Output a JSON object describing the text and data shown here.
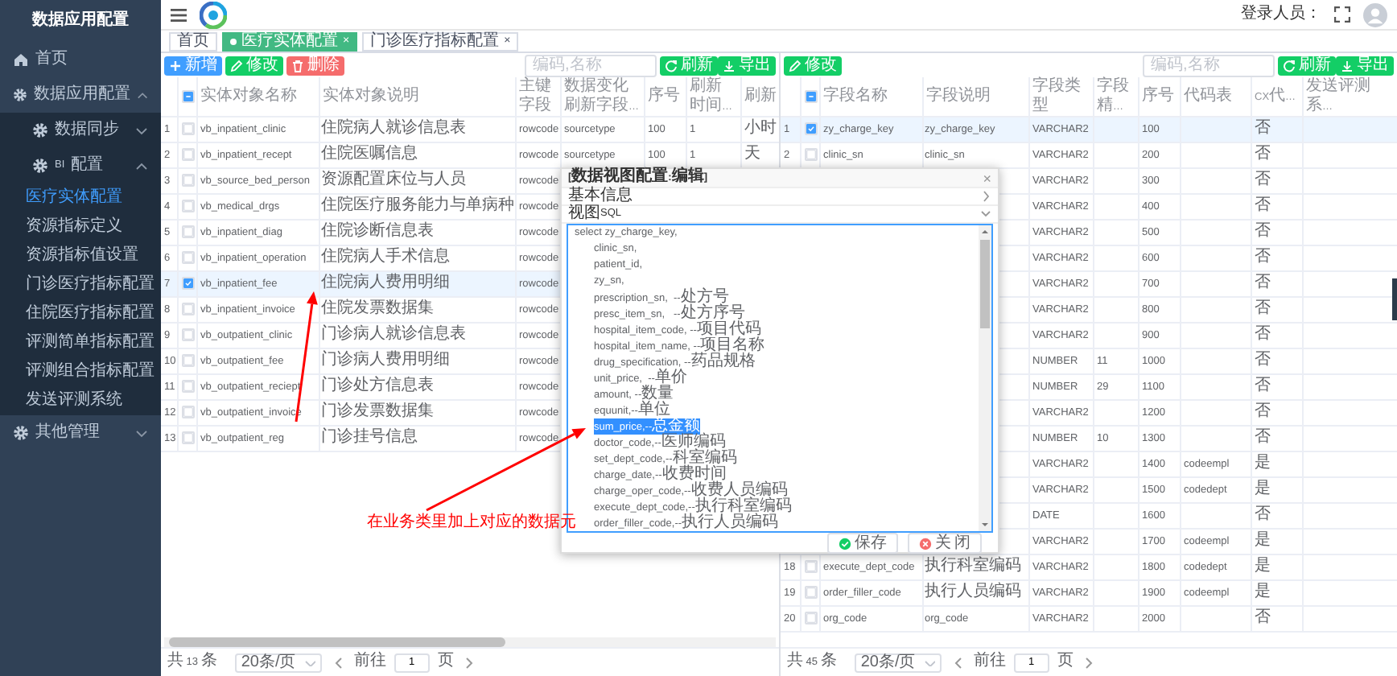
{
  "sidebar": {
    "title": "数据应用配置",
    "items": [
      {
        "label": "首页",
        "kind": "link"
      },
      {
        "label": "数据应用配置",
        "kind": "group",
        "expanded": true,
        "children": [
          {
            "label": "数据同步",
            "kind": "group",
            "expanded": false
          },
          {
            "label": "BI配置",
            "kind": "group",
            "expanded": true,
            "children": [
              {
                "label": "医疗实体配置",
                "selected": true
              },
              {
                "label": "资源指标定义",
                "selected": false
              },
              {
                "label": "资源指标值设置",
                "selected": false
              },
              {
                "label": "门诊医疗指标配置",
                "selected": false
              },
              {
                "label": "住院医疗指标配置",
                "selected": false
              },
              {
                "label": "评测简单指标配置",
                "selected": false
              },
              {
                "label": "评测组合指标配置",
                "selected": false
              },
              {
                "label": "发送评测系统",
                "selected": false
              }
            ]
          }
        ]
      },
      {
        "label": "其他管理",
        "kind": "group",
        "expanded": false
      }
    ]
  },
  "header": {
    "user_label": "登录人员："
  },
  "tabs": [
    {
      "label": "首页",
      "selected": false
    },
    {
      "label": "医疗实体配置",
      "selected": true,
      "close": "×"
    },
    {
      "label": "门诊医疗指标配置",
      "selected": false,
      "close": "×"
    }
  ],
  "left_panel": {
    "buttons": [
      {
        "label": "新增",
        "kind": "add"
      },
      {
        "label": "修改",
        "kind": "edit"
      },
      {
        "label": "删除",
        "kind": "delete"
      }
    ],
    "search": {
      "placeholder": "编码,名称"
    },
    "actions": [
      {
        "label": "刷新",
        "kind": "refresh"
      },
      {
        "label": "导出",
        "kind": "export"
      }
    ],
    "table": {
      "header_checkbox": {
        "partial": true
      },
      "columns": [
        "实体对象名称",
        "实体对象说明",
        "主键字段",
        "数据变化刷新字段…",
        "序号",
        "刷新时间…",
        "刷新"
      ],
      "rows": [
        {
          "index": "1",
          "checked": false,
          "selected": false,
          "cells": [
            "vb_inpatient_clinic",
            "住院病人就诊信息表",
            "rowcode",
            "sourcetype",
            "100",
            "1",
            "小时"
          ]
        },
        {
          "index": "2",
          "checked": false,
          "selected": false,
          "cells": [
            "vb_inpatient_recept",
            "住院医嘱信息",
            "rowcode",
            "sourcetype",
            "100",
            "1",
            "天"
          ]
        },
        {
          "index": "3",
          "checked": false,
          "selected": false,
          "cells": [
            "vb_source_bed_person",
            "资源配置床位与人员",
            "rowcode"
          ]
        },
        {
          "index": "4",
          "checked": false,
          "selected": false,
          "cells": [
            "vb_medical_drgs",
            "住院医疗服务能力与单病种",
            "rowcode"
          ]
        },
        {
          "index": "5",
          "checked": false,
          "selected": false,
          "cells": [
            "vb_inpatient_diag",
            "住院诊断信息表",
            "rowcode"
          ]
        },
        {
          "index": "6",
          "checked": false,
          "selected": false,
          "cells": [
            "vb_inpatient_operation",
            "住院病人手术信息",
            "rowcode"
          ]
        },
        {
          "index": "7",
          "checked": true,
          "selected": true,
          "cells": [
            "vb_inpatient_fee",
            "住院病人费用明细",
            "rowcode"
          ]
        },
        {
          "index": "8",
          "checked": false,
          "selected": false,
          "cells": [
            "vb_inpatient_invoice",
            "住院发票数据集",
            "rowcode"
          ]
        },
        {
          "index": "9",
          "checked": false,
          "selected": false,
          "cells": [
            "vb_outpatient_clinic",
            "门诊病人就诊信息表",
            "rowcode"
          ]
        },
        {
          "index": "10",
          "checked": false,
          "selected": false,
          "cells": [
            "vb_outpatient_fee",
            "门诊病人费用明细",
            "rowcode"
          ]
        },
        {
          "index": "11",
          "checked": false,
          "selected": false,
          "cells": [
            "vb_outpatient_reciept",
            "门诊处方信息表",
            "rowcode"
          ]
        },
        {
          "index": "12",
          "checked": false,
          "selected": false,
          "cells": [
            "vb_outpatient_invoice",
            "门诊发票数据集",
            "rowcode"
          ]
        },
        {
          "index": "13",
          "checked": false,
          "selected": false,
          "cells": [
            "vb_outpatient_reg",
            "门诊挂号信息",
            "rowcode"
          ]
        }
      ]
    },
    "pagination": {
      "total": "共 13 条",
      "page_size": "20条/页",
      "goto": "前往",
      "page": "1",
      "page_suffix": "页"
    }
  },
  "right_panel": {
    "buttons": [
      {
        "label": "修改",
        "kind": "edit"
      }
    ],
    "search": {
      "placeholder": "编码,名称"
    },
    "actions": [
      {
        "label": "刷新",
        "kind": "refresh"
      },
      {
        "label": "导出",
        "kind": "export"
      }
    ],
    "table": {
      "header_checkbox": {
        "partial": true
      },
      "columns": [
        "字段名称",
        "字段说明",
        "字段类型",
        "字段精…",
        "序号",
        "代码表",
        "CX代…",
        "发送评测系…"
      ],
      "rows": [
        {
          "index": "1",
          "checked": true,
          "selected": true,
          "cells": [
            "zy_charge_key",
            "zy_charge_key",
            "VARCHAR2",
            null,
            "100",
            null,
            "否"
          ]
        },
        {
          "index": "2",
          "checked": false,
          "selected": false,
          "cells": [
            "clinic_sn",
            "clinic_sn",
            "VARCHAR2",
            null,
            "200",
            null,
            "否"
          ]
        },
        {
          "selected": false,
          "cells": [
            null,
            null,
            "VARCHAR2",
            null,
            "300",
            null,
            "否"
          ]
        },
        {
          "selected": false,
          "cells": [
            null,
            null,
            "VARCHAR2",
            null,
            "400",
            null,
            "否"
          ]
        },
        {
          "selected": false,
          "cells": [
            null,
            null,
            "VARCHAR2",
            null,
            "500",
            null,
            "否"
          ]
        },
        {
          "selected": false,
          "cells": [
            null,
            null,
            "VARCHAR2",
            null,
            "600",
            null,
            "否"
          ]
        },
        {
          "selected": false,
          "cells": [
            null,
            null,
            "VARCHAR2",
            null,
            "700",
            null,
            "否"
          ]
        },
        {
          "selected": false,
          "cells": [
            null,
            null,
            "VARCHAR2",
            null,
            "800",
            null,
            "否"
          ]
        },
        {
          "selected": false,
          "cells": [
            null,
            null,
            "VARCHAR2",
            null,
            "900",
            null,
            "否"
          ]
        },
        {
          "selected": false,
          "cells": [
            null,
            null,
            "NUMBER",
            "11",
            "1000",
            null,
            "否"
          ]
        },
        {
          "selected": false,
          "cells": [
            null,
            null,
            "NUMBER",
            "29",
            "1100",
            null,
            "否"
          ]
        },
        {
          "selected": false,
          "cells": [
            null,
            null,
            "VARCHAR2",
            null,
            "1200",
            null,
            "否"
          ]
        },
        {
          "selected": false,
          "cells": [
            null,
            null,
            "NUMBER",
            "10",
            "1300",
            null,
            "否"
          ]
        },
        {
          "selected": false,
          "cells": [
            null,
            null,
            "VARCHAR2",
            null,
            "1400",
            "codeempl",
            "是"
          ]
        },
        {
          "selected": false,
          "cells": [
            null,
            null,
            "VARCHAR2",
            null,
            "1500",
            "codedept",
            "是"
          ]
        },
        {
          "selected": false,
          "cells": [
            null,
            null,
            "DATE",
            null,
            "1600",
            null,
            "否"
          ]
        },
        {
          "selected": false,
          "cells": [
            null,
            null,
            "VARCHAR2",
            null,
            "1700",
            "codeempl",
            "是"
          ]
        },
        {
          "index": "18",
          "checked": false,
          "selected": false,
          "cells": [
            "execute_dept_code",
            "执行科室编码",
            "VARCHAR2",
            null,
            "1800",
            "codedept",
            "是"
          ]
        },
        {
          "index": "19",
          "checked": false,
          "selected": false,
          "cells": [
            "order_filler_code",
            "执行人员编码",
            "VARCHAR2",
            null,
            "1900",
            "codeempl",
            "是"
          ]
        },
        {
          "index": "20",
          "checked": false,
          "selected": false,
          "cells": [
            "org_code",
            "org_code",
            "VARCHAR2",
            null,
            "2000",
            null,
            "否"
          ]
        }
      ]
    },
    "pagination": {
      "total": "共 45 条",
      "page_size": "20条/页",
      "goto": "前往",
      "page": "1",
      "page_suffix": "页"
    }
  },
  "dialog": {
    "title": "[数据视图配置:编辑]",
    "close": "×",
    "sections": [
      {
        "label": "基本信息",
        "expanded": false
      },
      {
        "label": "视图SQL",
        "expanded": true
      }
    ],
    "sql": {
      "text": "select zy_charge_key,",
      "selected": false,
      "children": [
        {
          "text": "clinic_sn,",
          "selected": false
        },
        {
          "text": "patient_id,",
          "selected": false
        },
        {
          "text": "zy_sn,",
          "selected": false
        },
        {
          "text": "prescription_sn,  --处方号",
          "selected": false
        },
        {
          "text": "presc_item_sn,   --处方序号",
          "selected": false
        },
        {
          "text": "hospital_item_code, --项目代码",
          "selected": false
        },
        {
          "text": "hospital_item_name, --项目名称",
          "selected": false
        },
        {
          "text": "drug_specification, --药品规格",
          "selected": false
        },
        {
          "text": "unit_price,  --单价",
          "selected": false
        },
        {
          "text": "amount, --数量",
          "selected": false
        },
        {
          "text": "equunit,--单位",
          "selected": false
        },
        {
          "text": "sum_price,--总金额",
          "selected": true
        },
        {
          "text": "doctor_code,--医师编码",
          "selected": false
        },
        {
          "text": "set_dept_code,--科室编码",
          "selected": false
        },
        {
          "text": "charge_date,--收费时间",
          "selected": false
        },
        {
          "text": "charge_oper_code,--收费人员编码",
          "selected": false
        },
        {
          "text": "execute_dept_code,--执行科室编码",
          "selected": false
        },
        {
          "text": "order_filler_code,--执行人员编码",
          "selected": false
        }
      ]
    },
    "buttons": [
      {
        "label": "保存",
        "kind": "save"
      },
      {
        "label": "关 闭",
        "kind": "close"
      }
    ]
  },
  "annotation": {
    "text": "在业务类里加上对应的数据元"
  }
}
